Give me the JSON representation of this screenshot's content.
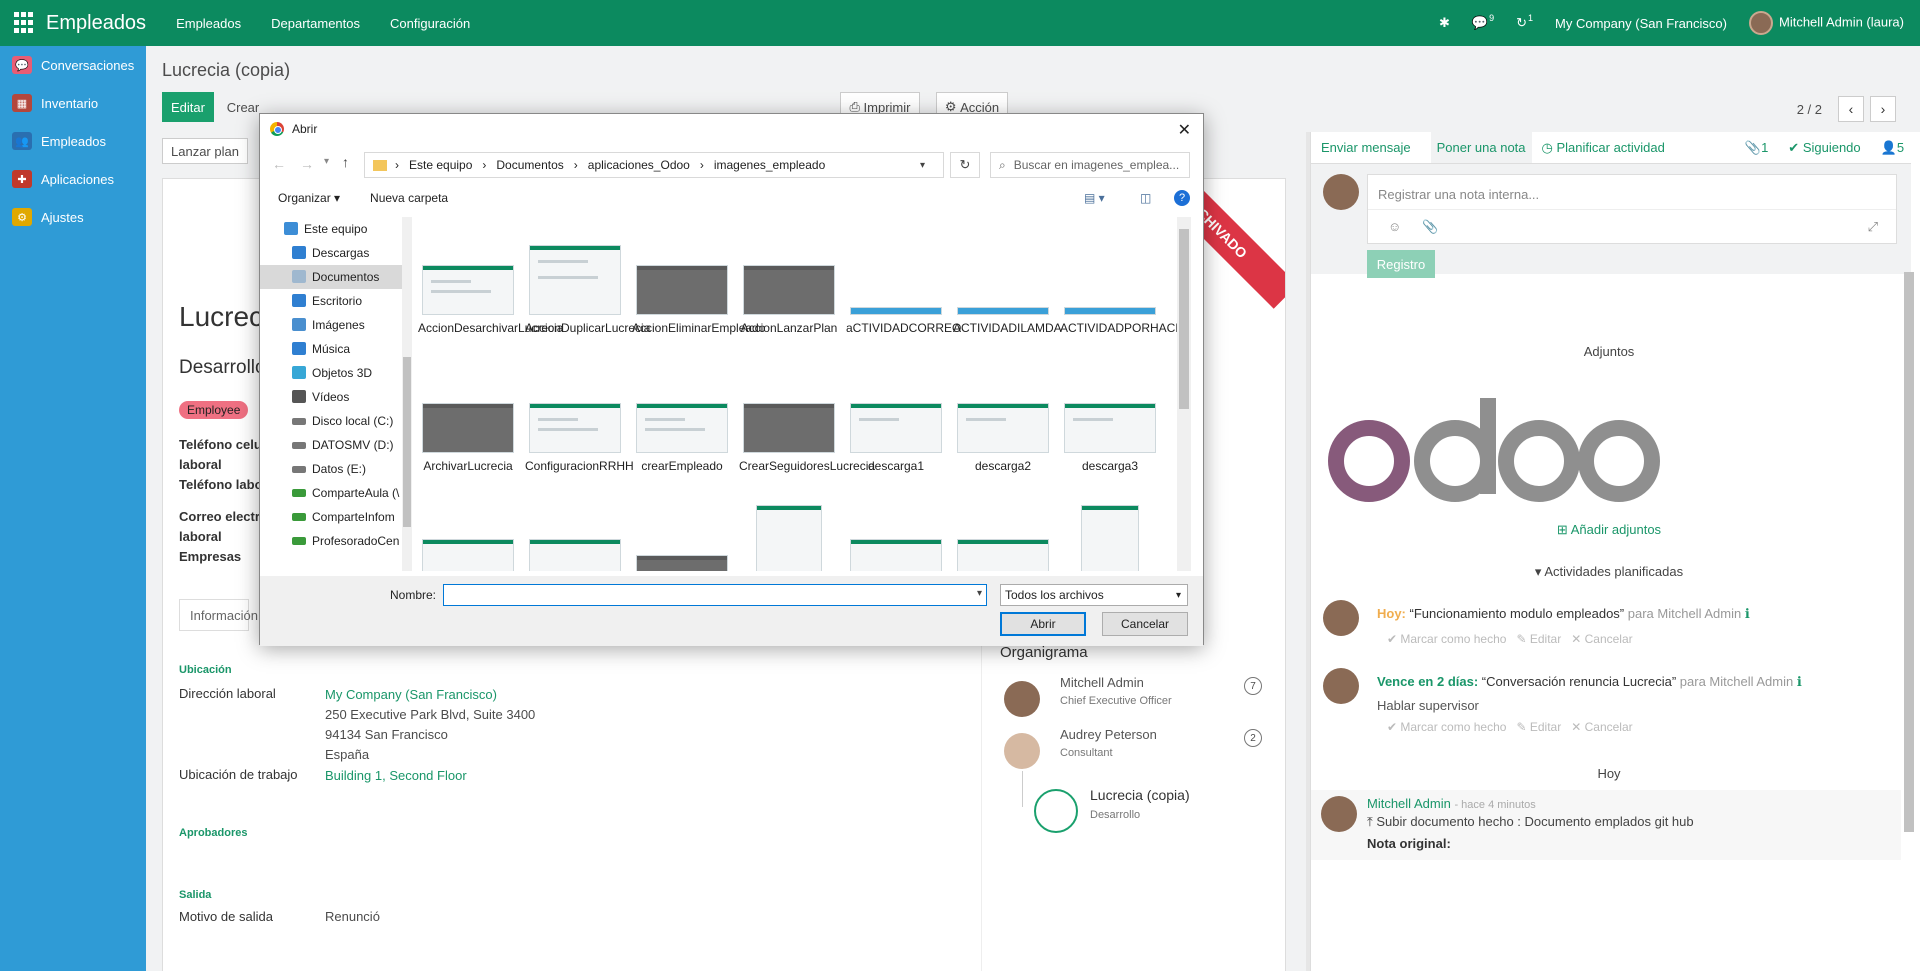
{
  "topbar": {
    "brand": "Empleados",
    "menu": [
      "Empleados",
      "Departamentos",
      "Configuración"
    ],
    "chat_badge": "9",
    "activity_badge": "1",
    "company": "My Company (San Francisco)",
    "user": "Mitchell Admin (laura)"
  },
  "sidebar": {
    "items": [
      {
        "label": "Conversaciones",
        "color": "#e85d75",
        "glyph": "💬"
      },
      {
        "label": "Inventario",
        "color": "#b3473c",
        "glyph": "▦"
      },
      {
        "label": "Empleados",
        "color": "#2a6fb0",
        "glyph": "👥"
      },
      {
        "label": "Aplicaciones",
        "color": "#c0392b",
        "glyph": "✚"
      },
      {
        "label": "Ajustes",
        "color": "#e0a800",
        "glyph": "⚙"
      }
    ]
  },
  "main": {
    "breadcrumb": "Lucrecia (copia)",
    "edit_label": "Editar",
    "create_label": "Crear",
    "print_label": "Imprimir",
    "action_label": "Acción",
    "pager": "2 / 2",
    "launch_plan": "Lanzar plan",
    "ribbon": "ARCHIVADO",
    "employee_name": "Lucreci",
    "job": "Desarrollo",
    "tag": "Employee",
    "fields": {
      "mobile": "Teléfono celular",
      "mobile2": "laboral",
      "phone": "Teléfono laboral",
      "email": "Correo electrónico",
      "email2": "laboral",
      "companies": "Empresas"
    },
    "tab_label": "Información",
    "section_location": "Ubicación",
    "work_address_label": "Dirección laboral",
    "work_address_company": "My Company (San Francisco)",
    "work_address_line1": "250 Executive Park Blvd, Suite 3400",
    "work_address_line2": "94134 San Francisco",
    "work_address_line3": "España",
    "work_location_label": "Ubicación de trabajo",
    "work_location": "Building 1, Second Floor",
    "section_approvers": "Aprobadores",
    "section_departure": "Salida",
    "departure_reason_label": "Motivo de salida",
    "departure_reason": "Renunció"
  },
  "org": {
    "title": "Organigrama",
    "people": [
      {
        "name": "Mitchell Admin",
        "role": "Chief Executive Officer",
        "count": "7"
      },
      {
        "name": "Audrey Peterson",
        "role": "Consultant",
        "count": "2"
      }
    ],
    "current_name": "Lucrecia (copia)",
    "current_role": "Desarrollo"
  },
  "chatter": {
    "send_message": "Enviar mensaje",
    "log_note": "Poner una nota",
    "schedule": "Planificar actividad",
    "attachments_count": "1",
    "following": "Siguiendo",
    "followers_count": "5",
    "note_placeholder": "Registrar una nota interna...",
    "log_button": "Registro",
    "attachments_title": "Adjuntos",
    "add_attachments": "Añadir adjuntos",
    "planned_title": "Actividades planificadas",
    "activities": [
      {
        "when": "Hoy:",
        "summary": "“Funcionamiento modulo empleados”",
        "for": "para Mitchell Admin",
        "note": ""
      },
      {
        "when": "Vence en 2 días:",
        "summary": "“Conversación renuncia Lucrecia”",
        "for": "para Mitchell Admin",
        "note": "Hablar supervisor"
      }
    ],
    "act_done": "Marcar como hecho",
    "act_edit": "Editar",
    "act_cancel": "Cancelar",
    "today": "Hoy",
    "msg_author": "Mitchell Admin",
    "msg_time": "- hace 4 minutos",
    "msg_text": "Subir documento hecho : Documento emplados git hub",
    "msg_note": "Nota original:"
  },
  "dialog": {
    "title": "Abrir",
    "path": [
      "Este equipo",
      "Documentos",
      "aplicaciones_Odoo",
      "imagenes_empleado"
    ],
    "search_placeholder": "Buscar en imagenes_emplea...",
    "organize": "Organizar",
    "new_folder": "Nueva carpeta",
    "nav": [
      {
        "label": "Este equipo",
        "color": "#3c8dd6"
      },
      {
        "label": "Descargas",
        "color": "#2f7fd1"
      },
      {
        "label": "Documentos",
        "color": "#9fb8cf"
      },
      {
        "label": "Escritorio",
        "color": "#2f7fd1"
      },
      {
        "label": "Imágenes",
        "color": "#4a8fcf"
      },
      {
        "label": "Música",
        "color": "#2f7fd1"
      },
      {
        "label": "Objetos 3D",
        "color": "#37a7d6"
      },
      {
        "label": "Vídeos",
        "color": "#555"
      },
      {
        "label": "Disco local (C:)",
        "color": "#777"
      },
      {
        "label": "DATOSMV (D:)",
        "color": "#777"
      },
      {
        "label": "Datos (E:)",
        "color": "#777"
      },
      {
        "label": "ComparteAula (\\",
        "color": "#3a9a3a"
      },
      {
        "label": "ComparteInfom",
        "color": "#3a9a3a"
      },
      {
        "label": "ProfesoradoCen",
        "color": "#3a9a3a"
      }
    ],
    "files_row1": [
      "AccionDesarchivarLucrecia",
      "AccionDuplicarLucrecia",
      "AccionEliminarEmpleado",
      "AccionLanzarPlan",
      "aCTIVIDADCORREO",
      "ACTIVIDADILAMDA",
      "ACTIVIDADPORHACER"
    ],
    "files_row2": [
      "ArchivarLucrecia",
      "ConfiguracionRRHH",
      "crearEmpleado",
      "CrearSeguidoresLucrecia",
      "descarga1",
      "descarga2",
      "descarga3"
    ],
    "name_label": "Nombre:",
    "file_type": "Todos los archivos",
    "open": "Abrir",
    "cancel": "Cancelar"
  }
}
